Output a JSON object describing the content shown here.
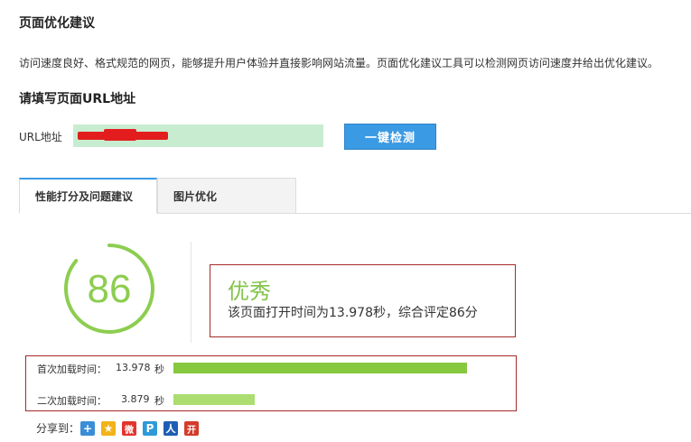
{
  "page": {
    "title": "页面优化建议",
    "description": "访问速度良好、格式规范的网页，能够提升用户体验并直接影响网站流量。页面优化建议工具可以检测网页访问速度并给出优化建议。"
  },
  "url_form": {
    "heading": "请填写页面URL地址",
    "label": "URL地址",
    "value": "",
    "check_button": "一键检测"
  },
  "tabs": [
    {
      "label": "性能打分及问题建议",
      "active": true
    },
    {
      "label": "图片优化",
      "active": false
    }
  ],
  "score": {
    "value": 86,
    "max": 100,
    "color": "#8dcd50",
    "rating": "优秀",
    "detail": "该页面打开时间为13.978秒，综合评定86分"
  },
  "load_times": [
    {
      "label": "首次加载时间：",
      "value": "13.978",
      "unit": "秒",
      "seconds": 13.978,
      "color": "#86c83e"
    },
    {
      "label": "二次加载时间：",
      "value": "3.879",
      "unit": "秒",
      "seconds": 3.879,
      "color": "#abdd70"
    }
  ],
  "share": {
    "label": "分享到：",
    "icons": [
      {
        "name": "plus-icon",
        "glyph": "+",
        "color": "#3a8ed8"
      },
      {
        "name": "qzone-star-icon",
        "glyph": "★",
        "color": "#f2b31a"
      },
      {
        "name": "weibo-icon",
        "glyph": "微",
        "color": "#e2352c"
      },
      {
        "name": "tencent-weibo-icon",
        "glyph": "P",
        "color": "#2f9ad8"
      },
      {
        "name": "renren-icon",
        "glyph": "人",
        "color": "#1d5fb3"
      },
      {
        "name": "kaixin-icon",
        "glyph": "开",
        "color": "#d43b2b"
      }
    ]
  }
}
